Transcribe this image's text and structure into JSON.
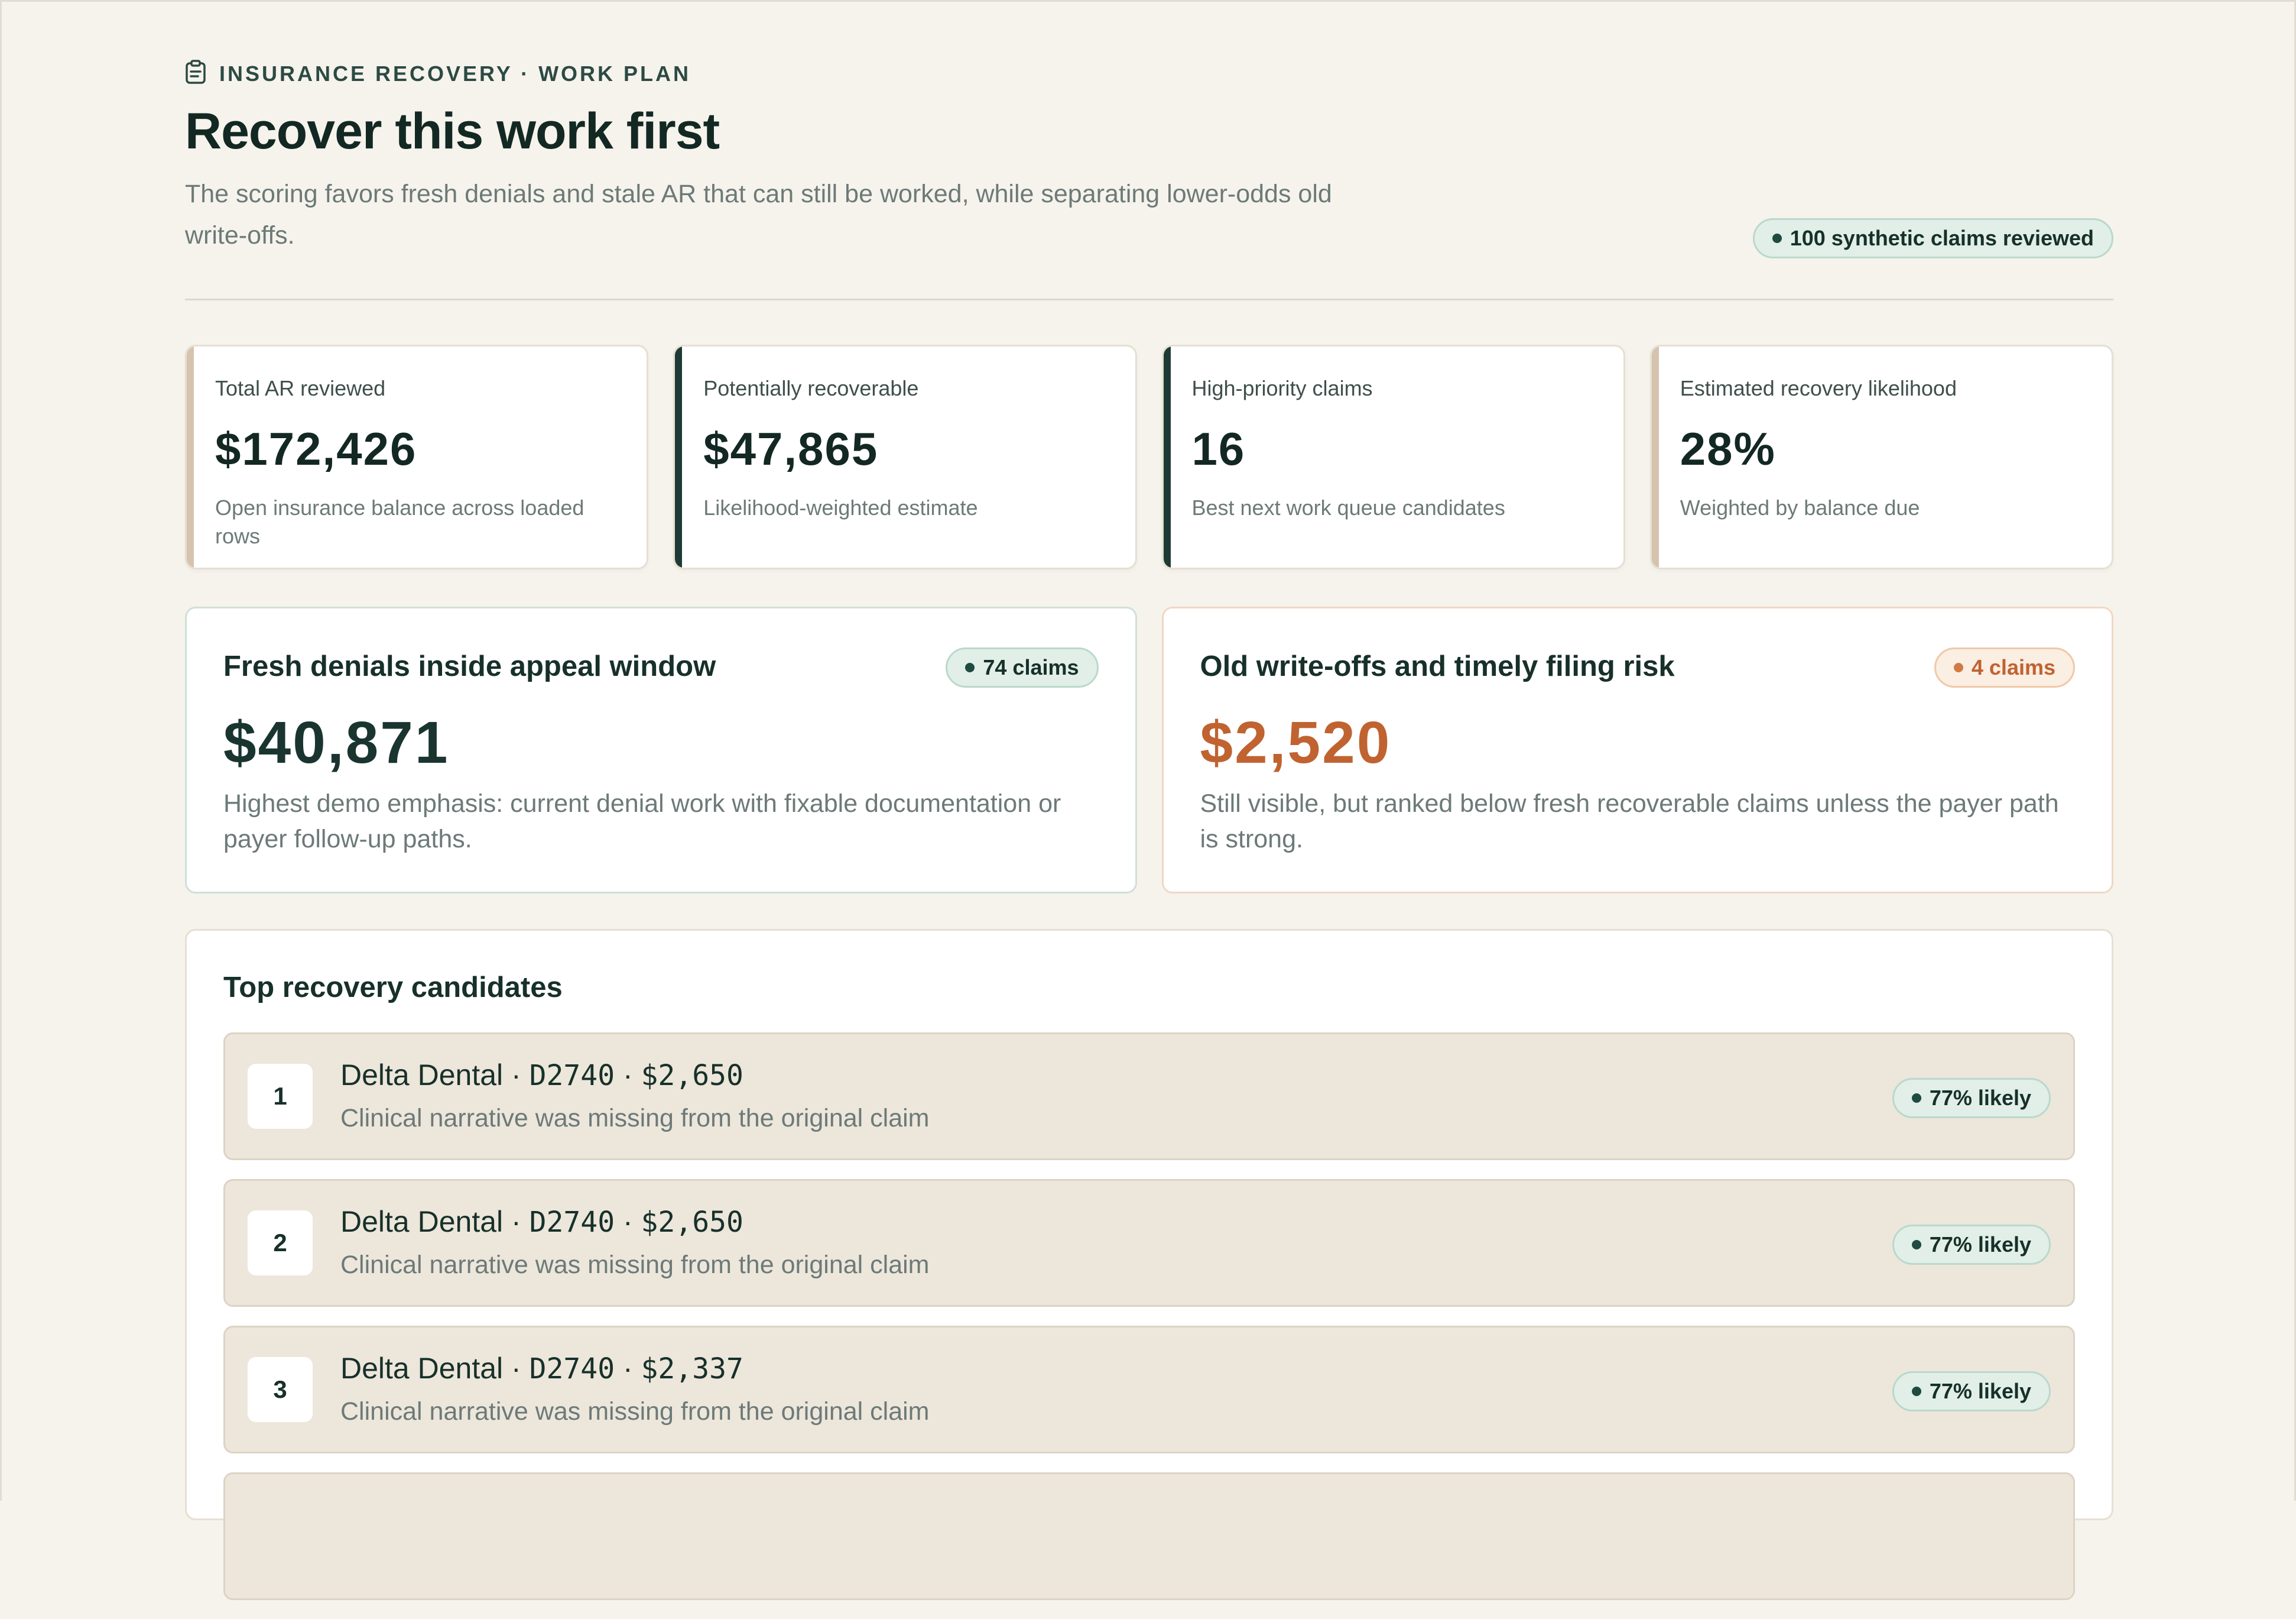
{
  "header": {
    "eyebrow": "INSURANCE RECOVERY · WORK PLAN",
    "eyebrow_icon": "clipboard-icon",
    "title": "Recover this work first",
    "subtitle": "The scoring favors fresh denials and stale AR that can still be worked, while separating lower-odds old write-offs.",
    "reviewed_badge": "100 synthetic claims reviewed"
  },
  "kpis": [
    {
      "label": "Total AR reviewed",
      "value": "$172,426",
      "note": "Open insurance balance across loaded rows",
      "accent": "#d6c3ad"
    },
    {
      "label": "Potentially recoverable",
      "value": "$47,865",
      "note": "Likelihood-weighted estimate",
      "accent": "#1f3a35"
    },
    {
      "label": "High-priority claims",
      "value": "16",
      "note": "Best next work queue candidates",
      "accent": "#1f3a35"
    },
    {
      "label": "Estimated recovery likelihood",
      "value": "28%",
      "note": "Weighted by balance due",
      "accent": "#d6c3ad"
    }
  ],
  "segments": {
    "fresh": {
      "title": "Fresh denials inside appeal window",
      "badge": "74 claims",
      "value": "$40,871",
      "description": "Highest demo emphasis: current denial work with fixable documentation or payer follow-up paths.",
      "color": "#1a3530"
    },
    "old": {
      "title": "Old write-offs and timely filing risk",
      "badge": "4 claims",
      "value": "$2,520",
      "description": "Still visible, but ranked below fresh recoverable claims unless the payer path is strong.",
      "color": "#c06330"
    }
  },
  "candidates": {
    "title": "Top recovery candidates",
    "rows": [
      {
        "rank": "1",
        "payer": "Delta Dental",
        "code": "D2740",
        "amount": "$2,650",
        "reason": "Clinical narrative was missing from the original claim",
        "likelihood": "77% likely"
      },
      {
        "rank": "2",
        "payer": "Delta Dental",
        "code": "D2740",
        "amount": "$2,650",
        "reason": "Clinical narrative was missing from the original claim",
        "likelihood": "77% likely"
      },
      {
        "rank": "3",
        "payer": "Delta Dental",
        "code": "D2740",
        "amount": "$2,337",
        "reason": "Clinical narrative was missing from the original claim",
        "likelihood": "77% likely"
      }
    ]
  }
}
